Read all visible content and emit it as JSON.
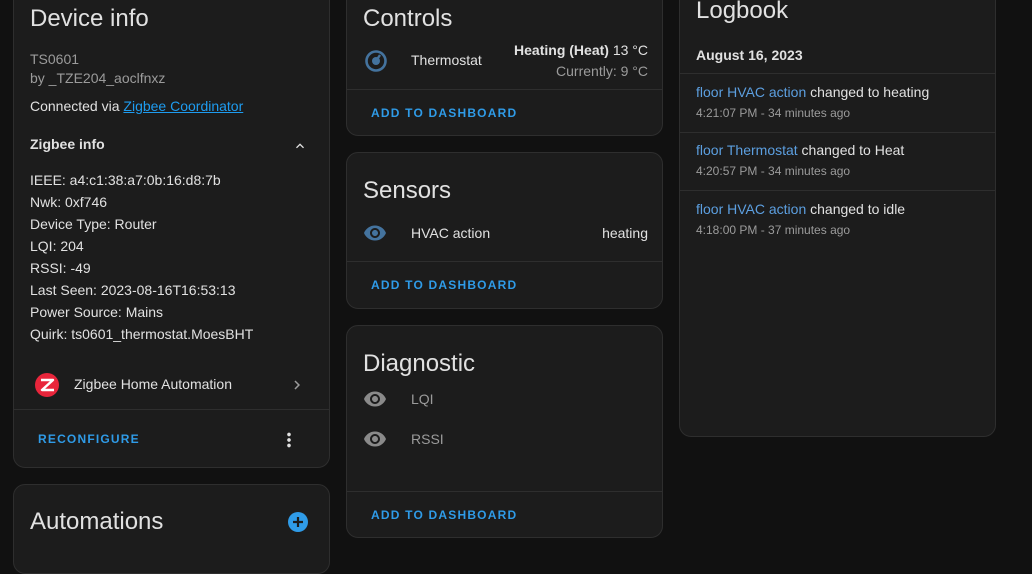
{
  "device_info": {
    "title": "Device info",
    "model": "TS0601",
    "manufacturer": "by _TZE204_aoclfnxz",
    "connected_via_prefix": "Connected via ",
    "connected_via_link": "Zigbee Coordinator",
    "zigbee_info_title": "Zigbee info",
    "zigbee_rows": [
      "IEEE: a4:c1:38:a7:0b:16:d8:7b",
      "Nwk: 0xf746",
      "Device Type: Router",
      "LQI: 204",
      "RSSI: -49",
      "Last Seen: 2023-08-16T16:53:13",
      "Power Source: Mains",
      "Quirk: ts0601_thermostat.MoesBHT"
    ],
    "integration_label": "Zigbee Home Automation",
    "reconfigure_label": "RECONFIGURE"
  },
  "automations": {
    "title": "Automations"
  },
  "controls": {
    "title": "Controls",
    "entity_name": "Thermostat",
    "state_mode": "Heating (Heat)",
    "state_target": " 13 °C",
    "state_current": "Currently: 9 °C",
    "add_label": "ADD TO DASHBOARD"
  },
  "sensors": {
    "title": "Sensors",
    "entity_name": "HVAC action",
    "entity_state": "heating",
    "add_label": "ADD TO DASHBOARD"
  },
  "diagnostic": {
    "title": "Diagnostic",
    "rows": [
      "LQI",
      "RSSI"
    ],
    "add_label": "ADD TO DASHBOARD"
  },
  "logbook": {
    "title": "Logbook",
    "date": "August 16, 2023",
    "entries": [
      {
        "entity": "floor HVAC action",
        "message": " changed to heating",
        "time": "4:21:07 PM - 34 minutes ago"
      },
      {
        "entity": "floor Thermostat",
        "message": " changed to Heat",
        "time": "4:20:57 PM - 34 minutes ago"
      },
      {
        "entity": "floor HVAC action",
        "message": " changed to idle",
        "time": "4:18:00 PM - 37 minutes ago"
      }
    ]
  },
  "colors": {
    "accent": "#2f9be7",
    "link": "#5c9fe0",
    "zigbee_logo": "#e8253b",
    "card_bg": "#1c1c1c",
    "page_bg": "#111111"
  }
}
